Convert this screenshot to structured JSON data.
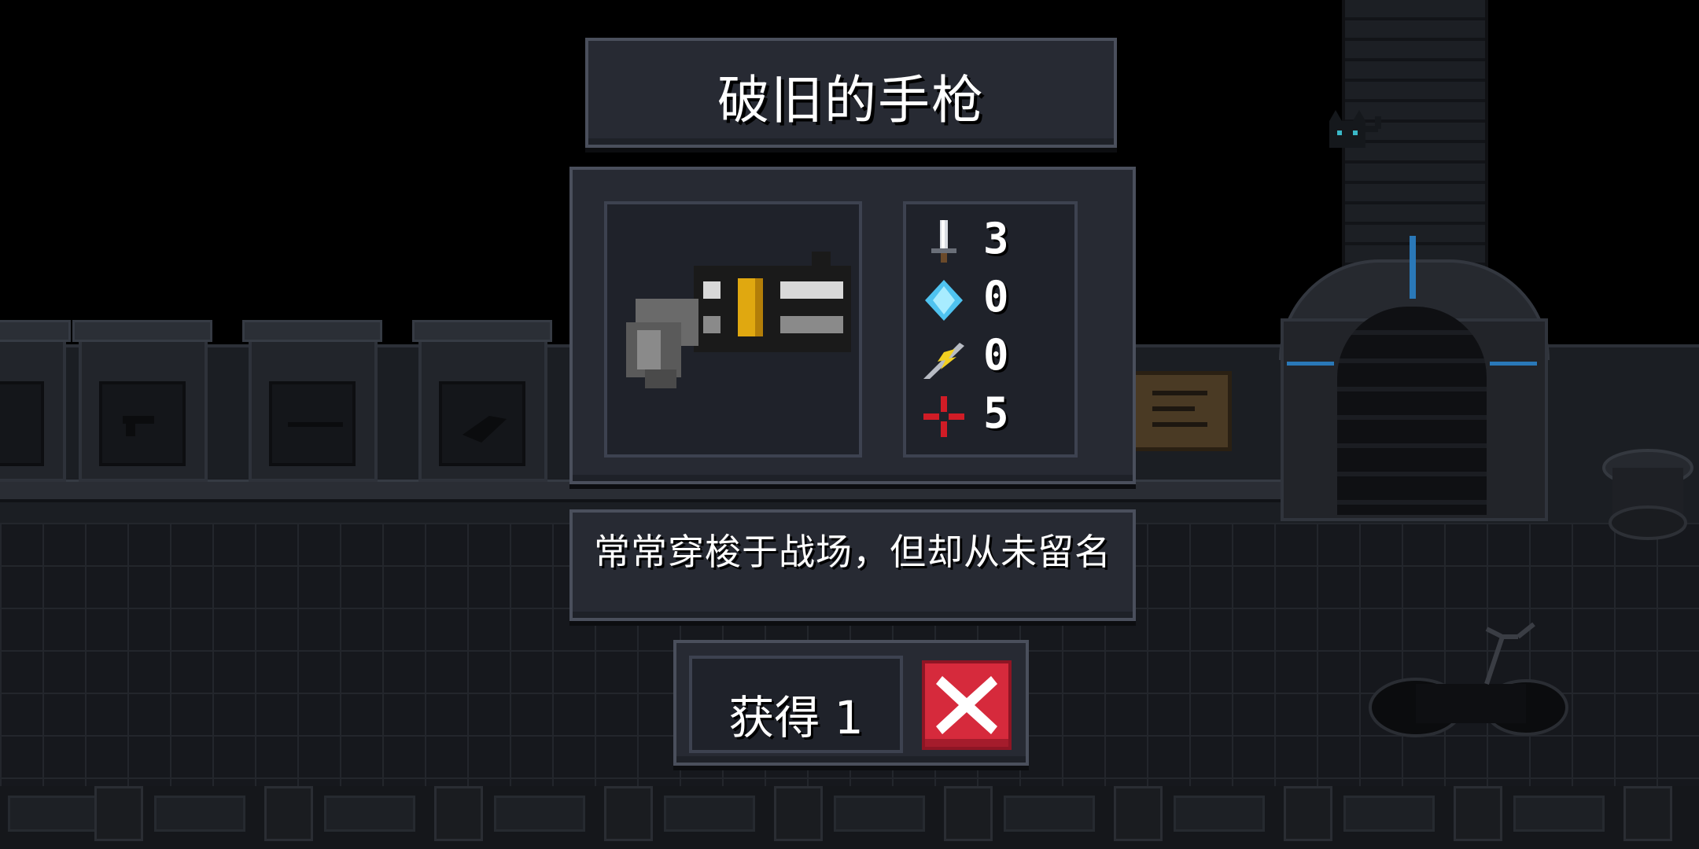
{
  "dialog": {
    "title": "破旧的手枪",
    "stats": [
      {
        "icon": "sword-icon",
        "value": "3"
      },
      {
        "icon": "energy-crystal-icon",
        "value": "0"
      },
      {
        "icon": "crit-feather-icon",
        "value": "0"
      },
      {
        "icon": "crosshair-icon",
        "value": "5"
      }
    ],
    "description": "常常穿梭于战场，但却从未留名",
    "obtain_label": "获得 1",
    "close_icon": "close-x-icon"
  },
  "colors": {
    "panel": "#272a33",
    "panel_border": "#4a4f5c",
    "close_button": "#d62a3c",
    "gate_accent": "#2a78b8"
  }
}
